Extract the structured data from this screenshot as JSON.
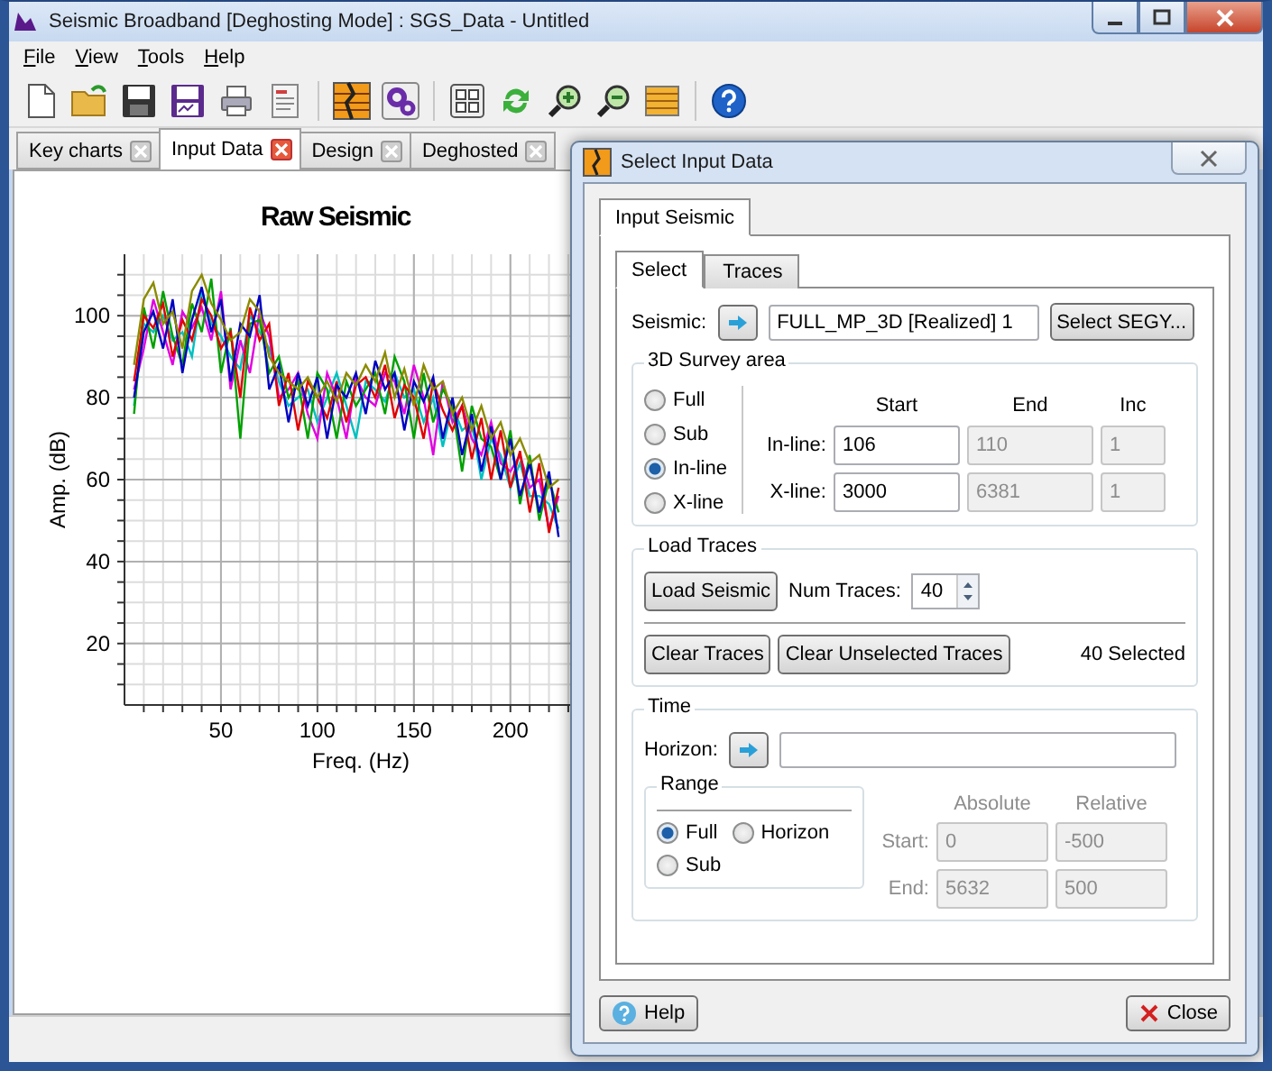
{
  "window": {
    "title": "Seismic Broadband [Deghosting Mode] : SGS_Data - Untitled"
  },
  "menu": [
    {
      "label": "File"
    },
    {
      "label": "View"
    },
    {
      "label": "Tools"
    },
    {
      "label": "Help"
    }
  ],
  "tabs": [
    {
      "label": "Key charts",
      "selected": false
    },
    {
      "label": "Input Data",
      "selected": true
    },
    {
      "label": "Design",
      "selected": false
    },
    {
      "label": "Deghosted",
      "selected": false
    }
  ],
  "chart_data": {
    "type": "line",
    "title": "Raw Seismic",
    "xlabel": "Freq. (Hz)",
    "ylabel": "Amp. (dB)",
    "xlim": [
      0,
      245
    ],
    "ylim": [
      5,
      115
    ],
    "xticks": [
      50,
      100,
      150,
      200
    ],
    "yticks": [
      100,
      80,
      60,
      40,
      20
    ],
    "x": [
      5,
      10,
      15,
      20,
      25,
      30,
      35,
      40,
      45,
      50,
      55,
      60,
      65,
      70,
      75,
      80,
      85,
      90,
      95,
      100,
      105,
      110,
      115,
      120,
      125,
      130,
      135,
      140,
      145,
      150,
      155,
      160,
      165,
      170,
      175,
      180,
      185,
      190,
      195,
      200,
      205,
      210,
      215,
      220,
      225
    ],
    "series": [
      {
        "color": "#00c0c0",
        "values": [
          78,
          98,
          96,
          100,
          94,
          96,
          90,
          106,
          98,
          95,
          90,
          87,
          100,
          96,
          92,
          84,
          78,
          80,
          82,
          74,
          80,
          86,
          78,
          70,
          84,
          82,
          79,
          86,
          80,
          82,
          74,
          80,
          68,
          78,
          72,
          74,
          60,
          70,
          66,
          58,
          64,
          56,
          56,
          54,
          48
        ]
      },
      {
        "color": "#e000e0",
        "values": [
          82,
          92,
          104,
          96,
          88,
          101,
          97,
          102,
          94,
          106,
          82,
          94,
          86,
          101,
          95,
          80,
          82,
          86,
          76,
          70,
          86,
          80,
          70,
          85,
          80,
          78,
          86,
          84,
          76,
          88,
          80,
          66,
          84,
          74,
          78,
          70,
          66,
          74,
          64,
          62,
          66,
          58,
          60,
          48,
          56
        ]
      },
      {
        "color": "#00a000",
        "values": [
          76,
          102,
          92,
          106,
          95,
          88,
          103,
          96,
          109,
          86,
          97,
          70,
          98,
          99,
          86,
          90,
          80,
          84,
          70,
          86,
          82,
          70,
          84,
          78,
          82,
          86,
          76,
          90,
          84,
          70,
          86,
          74,
          82,
          78,
          62,
          78,
          70,
          68,
          60,
          72,
          54,
          66,
          50,
          60,
          52
        ]
      },
      {
        "color": "#e00000",
        "values": [
          84,
          100,
          97,
          103,
          90,
          99,
          94,
          104,
          100,
          92,
          96,
          80,
          102,
          94,
          98,
          78,
          86,
          72,
          84,
          80,
          75,
          84,
          74,
          83,
          85,
          80,
          88,
          75,
          83,
          80,
          70,
          84,
          77,
          72,
          78,
          65,
          75,
          60,
          72,
          58,
          67,
          52,
          64,
          47,
          58
        ]
      },
      {
        "color": "#0000c0",
        "values": [
          80,
          96,
          101,
          92,
          104,
          86,
          99,
          107,
          96,
          104,
          84,
          98,
          95,
          105,
          82,
          88,
          74,
          86,
          78,
          85,
          70,
          83,
          80,
          86,
          76,
          89,
          82,
          86,
          72,
          84,
          79,
          85,
          70,
          80,
          66,
          76,
          62,
          73,
          60,
          70,
          56,
          64,
          52,
          62,
          46
        ]
      },
      {
        "color": "#8b8b00",
        "values": [
          88,
          104,
          108,
          98,
          101,
          92,
          106,
          110,
          103,
          99,
          94,
          96,
          104,
          101,
          90,
          86,
          84,
          82,
          85,
          80,
          84,
          79,
          86,
          83,
          88,
          84,
          91,
          80,
          87,
          78,
          88,
          82,
          84,
          76,
          80,
          72,
          78,
          70,
          74,
          66,
          70,
          64,
          66,
          58,
          60
        ]
      }
    ],
    "grid": true
  },
  "dialog": {
    "title": "Select Input Data",
    "tabs": [
      {
        "label": "Input Seismic",
        "selected": true
      }
    ],
    "subtabs": [
      {
        "label": "Select",
        "selected": true
      },
      {
        "label": "Traces",
        "selected": false
      }
    ],
    "seismic": {
      "label": "Seismic:",
      "value": "FULL_MP_3D [Realized] 1",
      "button": "Select SEGY..."
    },
    "survey": {
      "title": "3D Survey area",
      "options": [
        {
          "label": "Full",
          "selected": false
        },
        {
          "label": "Sub",
          "selected": false
        },
        {
          "label": "In-line",
          "selected": true
        },
        {
          "label": "X-line",
          "selected": false
        }
      ],
      "columns": [
        {
          "label": "Start",
          "disabled": false
        },
        {
          "label": "End",
          "disabled": false
        },
        {
          "label": "Inc",
          "disabled": false
        }
      ],
      "rows": [
        {
          "label": "In-line:",
          "disabled": false,
          "fields": [
            {
              "value": "106",
              "disabled": false
            },
            {
              "value": "110",
              "disabled": true
            },
            {
              "value": "1",
              "disabled": true
            }
          ]
        },
        {
          "label": "X-line:",
          "disabled": false,
          "fields": [
            {
              "value": "3000",
              "disabled": false
            },
            {
              "value": "6381",
              "disabled": true
            },
            {
              "value": "1",
              "disabled": true
            }
          ]
        }
      ]
    },
    "load": {
      "title": "Load Traces",
      "load_button": "Load Seismic",
      "num_label": "Num Traces:",
      "num_value": "40",
      "clear_button": "Clear Traces",
      "clear_unselected_button": "Clear Unselected Traces",
      "status": "40 Selected"
    },
    "time": {
      "title": "Time",
      "horizon_label": "Horizon:",
      "range": {
        "title": "Range",
        "options": [
          {
            "label": "Full",
            "selected": true
          },
          {
            "label": "Horizon",
            "selected": false
          },
          {
            "label": "Sub",
            "selected": false
          }
        ]
      },
      "columns": [
        {
          "label": "Absolute",
          "disabled": true
        },
        {
          "label": "Relative",
          "disabled": true
        }
      ],
      "rows": [
        {
          "label": "Start:",
          "disabled": true,
          "fields": [
            {
              "value": "0",
              "disabled": true
            },
            {
              "value": "-500",
              "disabled": true
            }
          ]
        },
        {
          "label": "End:",
          "disabled": true,
          "fields": [
            {
              "value": "5632",
              "disabled": true
            },
            {
              "value": "500",
              "disabled": true
            }
          ]
        }
      ]
    },
    "buttons": [
      {
        "label": "Help",
        "kind": "help"
      },
      {
        "label": "Close",
        "kind": "close"
      }
    ]
  }
}
